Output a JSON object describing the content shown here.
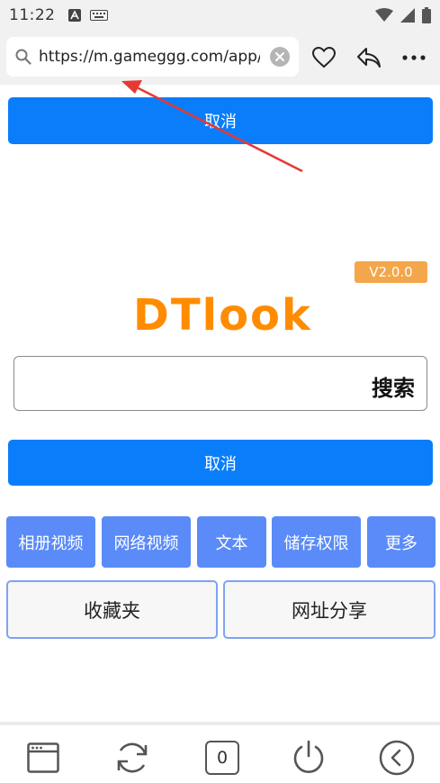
{
  "status_bar": {
    "time": "11:22"
  },
  "url_bar": {
    "url": "https://m.gameggg.com/app/"
  },
  "top_cancel_label": "取消",
  "version": "V2.0.0",
  "logo": "DTlook",
  "search": {
    "button_label": "搜索",
    "value": ""
  },
  "cancel_label": "取消",
  "chips": [
    {
      "label": "相册视频"
    },
    {
      "label": "网络视频"
    },
    {
      "label": "文本"
    },
    {
      "label": "储存权限"
    },
    {
      "label": "更多"
    }
  ],
  "actions": {
    "favorites": "收藏夹",
    "share_url": "网址分享"
  },
  "bottom_bar": {
    "tab_count": "0"
  },
  "colors": {
    "primary_blue": "#0a7dfb",
    "chip_blue": "#5a8bf8",
    "logo_orange": "#ff8c00",
    "badge_orange": "#f4a64a",
    "annotation_red": "#e53935"
  },
  "icons": {
    "url_bar": [
      "search-icon",
      "clear-icon",
      "heart-icon",
      "share-icon",
      "more-icon"
    ],
    "bottom_bar": [
      "window-icon",
      "refresh-icon",
      "tabs-icon",
      "power-icon",
      "back-icon"
    ]
  }
}
